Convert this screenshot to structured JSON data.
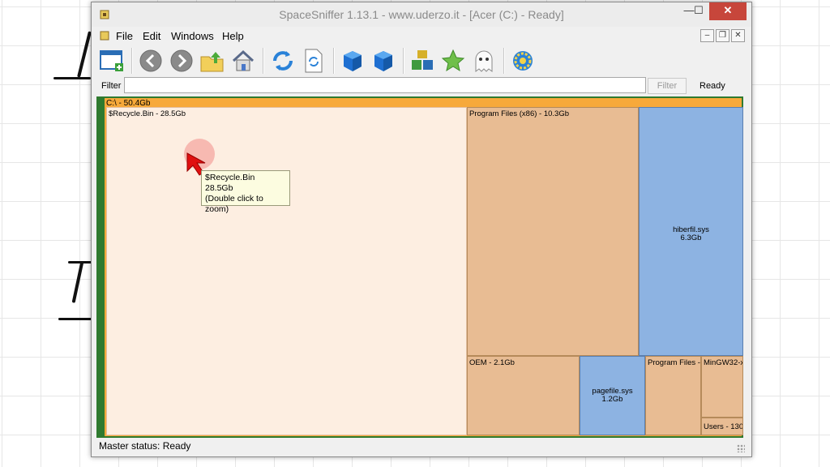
{
  "window": {
    "title": "SpaceSniffer 1.13.1 - www.uderzo.it - [Acer (C:) - Ready]",
    "caption_min": "—",
    "caption_max": "☐",
    "caption_close": "✕"
  },
  "menu": {
    "items": [
      "File",
      "Edit",
      "Windows",
      "Help"
    ],
    "mdi_min": "–",
    "mdi_restore": "❐",
    "mdi_close": "✕"
  },
  "toolbar": {
    "icons": [
      "new-window-icon",
      "back-icon",
      "forward-icon",
      "up-folder-icon",
      "home-icon",
      "refresh-icon",
      "rescan-icon",
      "blue-cube-icon",
      "blue-cube-alt-icon",
      "colored-blocks-icon",
      "star-icon",
      "ghost-icon",
      "settings-gear-icon"
    ]
  },
  "filter": {
    "label": "Filter",
    "value": "",
    "button": "Filter",
    "status": "Ready"
  },
  "treemap": {
    "root": "C:\\ - 50.4Gb",
    "recycle": "$Recycle.Bin - 28.5Gb",
    "program_files_x86": "Program Files (x86) - 10.3Gb",
    "hiberfil_name": "hiberfil.sys",
    "hiberfil_size": "6.3Gb",
    "oem": "OEM - 2.1Gb",
    "pagefile_name": "pagefile.sys",
    "pagefile_size": "1.2Gb",
    "program_files": "Program Files -",
    "mingw": "MinGW32-x",
    "users": "Users - 130."
  },
  "tooltip": {
    "name": "$Recycle.Bin",
    "size": "28.5Gb",
    "hint": "(Double click to zoom)"
  },
  "status": {
    "text": "Master status: Ready"
  },
  "colors": {
    "folder": "#e8bc93",
    "folder_highlight": "#fdeee1",
    "file": "#8db3e2",
    "root": "#f7a93a"
  }
}
